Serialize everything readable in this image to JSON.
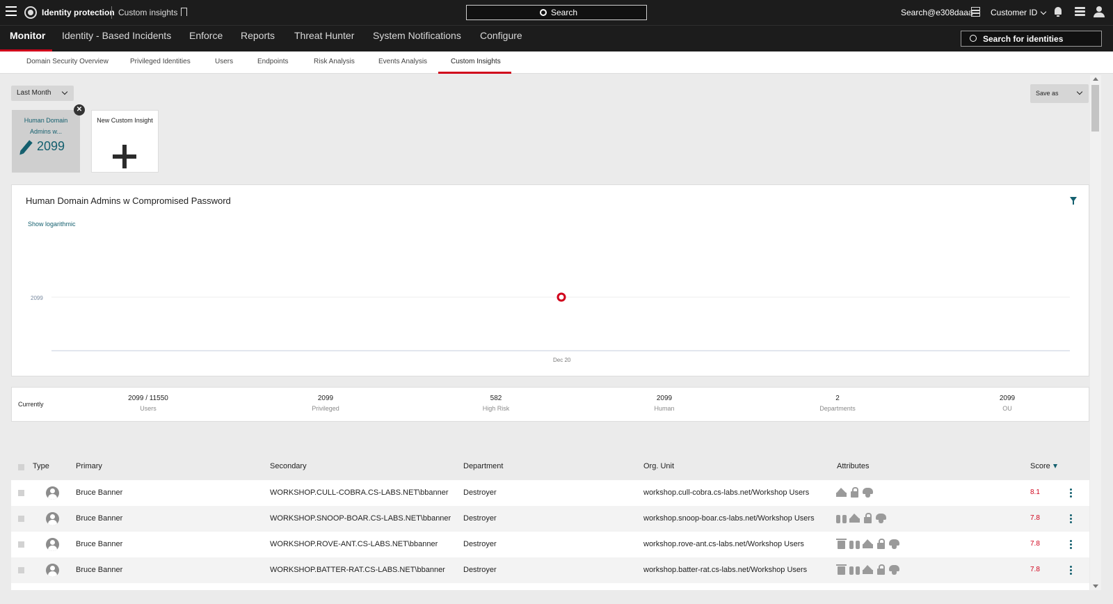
{
  "topbar": {
    "app_title": "Identity protection",
    "page_crumb": "Custom insights",
    "search_label": "Search",
    "user": "Search@e308daaa",
    "customer": "Customer ID"
  },
  "mainnav": {
    "items": [
      "Monitor",
      "Identity - Based Incidents",
      "Enforce",
      "Reports",
      "Threat Hunter",
      "System Notifications",
      "Configure"
    ],
    "identity_search": "Search for identities"
  },
  "subtabs": [
    "Domain Security Overview",
    "Privileged Identities",
    "Users",
    "Endpoints",
    "Risk Analysis",
    "Events Analysis",
    "Custom Insights"
  ],
  "controls": {
    "time_range": "Last Month",
    "save_as": "Save as"
  },
  "cards": {
    "insight_title_line1": "Human Domain",
    "insight_title_line2": "Admins w...",
    "insight_value": "2099",
    "close_label": "✕",
    "new_label": "New Custom Insight"
  },
  "chart": {
    "show_log": "Show logarithmic"
  },
  "chart_data": {
    "type": "scatter",
    "title": "Human Domain Admins w Compromised Password",
    "x": [
      "Dec 20"
    ],
    "values": [
      2099
    ],
    "ytick_labels": [
      "2099"
    ],
    "xtick_labels": [
      "Dec 20"
    ],
    "point_color": "#d0021b",
    "grid": true
  },
  "stats": {
    "label": "Currently",
    "items": [
      {
        "value": "2099 / 11550",
        "key": "Users"
      },
      {
        "value": "2099",
        "key": "Privileged"
      },
      {
        "value": "582",
        "key": "High Risk"
      },
      {
        "value": "2099",
        "key": "Human"
      },
      {
        "value": "2",
        "key": "Departments"
      },
      {
        "value": "2099",
        "key": "OU"
      }
    ]
  },
  "table": {
    "columns": {
      "type": "Type",
      "primary": "Primary",
      "secondary": "Secondary",
      "department": "Department",
      "ou": "Org. Unit",
      "attributes": "Attributes",
      "score": "Score"
    },
    "rows": [
      {
        "primary": "Bruce Banner",
        "secondary": "WORKSHOP.CULL-COBRA.CS-LABS.NET\\bbanner",
        "department": "Destroyer",
        "ou": "workshop.cull-cobra.cs-labs.net/Workshop Users",
        "score": "8.1",
        "attrs": [
          "crown",
          "lock",
          "mask"
        ]
      },
      {
        "primary": "Bruce Banner",
        "secondary": "WORKSHOP.SNOOP-BOAR.CS-LABS.NET\\bbanner",
        "department": "Destroyer",
        "ou": "workshop.snoop-boar.cs-labs.net/Workshop Users",
        "score": "7.8",
        "attrs": [
          "binoculars",
          "crown",
          "lock",
          "mask"
        ]
      },
      {
        "primary": "Bruce Banner",
        "secondary": "WORKSHOP.ROVE-ANT.CS-LABS.NET\\bbanner",
        "department": "Destroyer",
        "ou": "workshop.rove-ant.cs-labs.net/Workshop Users",
        "score": "7.8",
        "attrs": [
          "bin",
          "binoculars",
          "crown",
          "lock",
          "mask"
        ]
      },
      {
        "primary": "Bruce Banner",
        "secondary": "WORKSHOP.BATTER-RAT.CS-LABS.NET\\bbanner",
        "department": "Destroyer",
        "ou": "workshop.batter-rat.cs-labs.net/Workshop Users",
        "score": "7.8",
        "attrs": [
          "bin",
          "binoculars",
          "crown",
          "lock",
          "mask"
        ]
      }
    ]
  }
}
